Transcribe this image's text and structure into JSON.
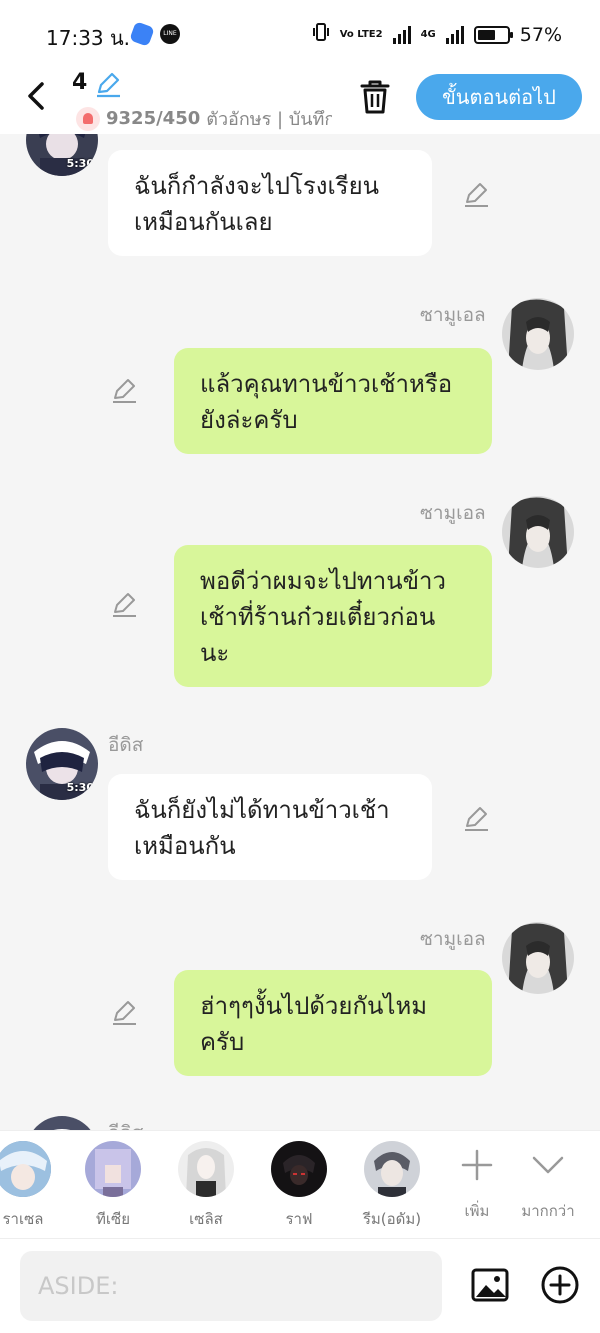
{
  "status": {
    "time": "17:33 น.",
    "network_label": "Vo LTE2",
    "net_4g": "4G",
    "battery": "57%"
  },
  "header": {
    "episode": "4",
    "char_count": "9325/450",
    "char_label": "ตัวอักษร | บันทึก",
    "next_button": "ขั้นตอนต่อไป"
  },
  "messages": [
    {
      "side": "left",
      "sender": "",
      "avatar_time": "5:30",
      "text_lines": [
        "ฉันก็กำลังจะไปโรงเรียน",
        "เหมือนกันเลย"
      ]
    },
    {
      "side": "right",
      "sender": "ซามูเอล",
      "text_lines": [
        "แล้วคุณทานข้าวเช้าหรือ",
        "ยังล่ะครับ"
      ]
    },
    {
      "side": "right",
      "sender": "ซามูเอล",
      "text_lines": [
        "พอดีว่าผมจะไปทานข้าว",
        "เช้าที่ร้านก๋วยเตี๋ยวก่อน",
        "นะ"
      ]
    },
    {
      "side": "left",
      "sender": "อีดิส",
      "avatar_time": "5:30",
      "text_lines": [
        "ฉันก็ยังไม่ได้ทานข้าวเช้า",
        "เหมือนกัน"
      ]
    },
    {
      "side": "right",
      "sender": "ซามูเอล",
      "text_lines": [
        "ฮ่าๆๆงั้นไปด้วยกันไหม",
        "ครับ"
      ]
    },
    {
      "side": "left",
      "sender": "อีดิส"
    }
  ],
  "characters": [
    {
      "name": "ราเซล",
      "color": "#6b8fb8"
    },
    {
      "name": "ทีเซีย",
      "color": "#8d8fc6"
    },
    {
      "name": "เซลิส",
      "color": "#cfcfcf"
    },
    {
      "name": "ราฟ",
      "color": "#1c1a1c"
    },
    {
      "name": "รีม(อดัม)",
      "color": "#7c8090"
    }
  ],
  "actions": {
    "add": "เพิ่ม",
    "more": "มากกว่า"
  },
  "input": {
    "placeholder": "ASIDE:"
  }
}
